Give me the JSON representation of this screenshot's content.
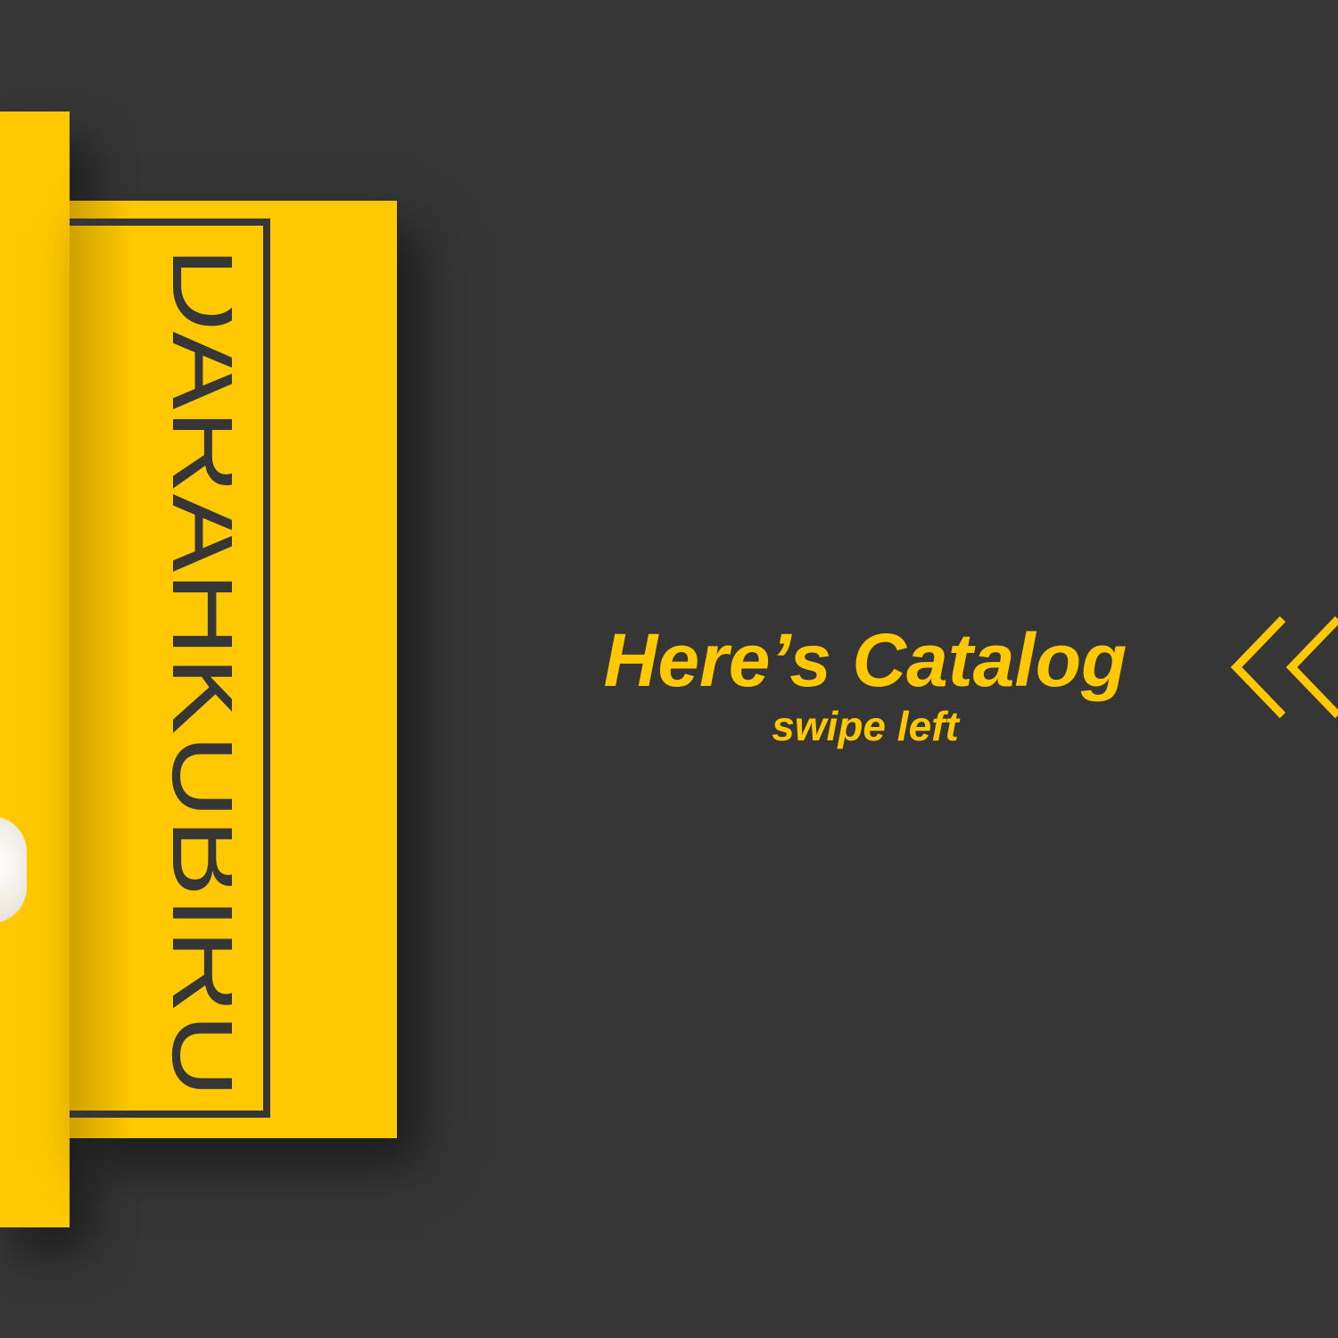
{
  "colors": {
    "background": "#363636",
    "accent": "#FFC800",
    "text_dark": "#363636"
  },
  "brand": {
    "name": "DARAHKUBIRU"
  },
  "cta": {
    "title": "Here’s Catalog",
    "subtitle": "swipe left"
  },
  "icons": {
    "swipe": "double-chevron-left-icon"
  }
}
